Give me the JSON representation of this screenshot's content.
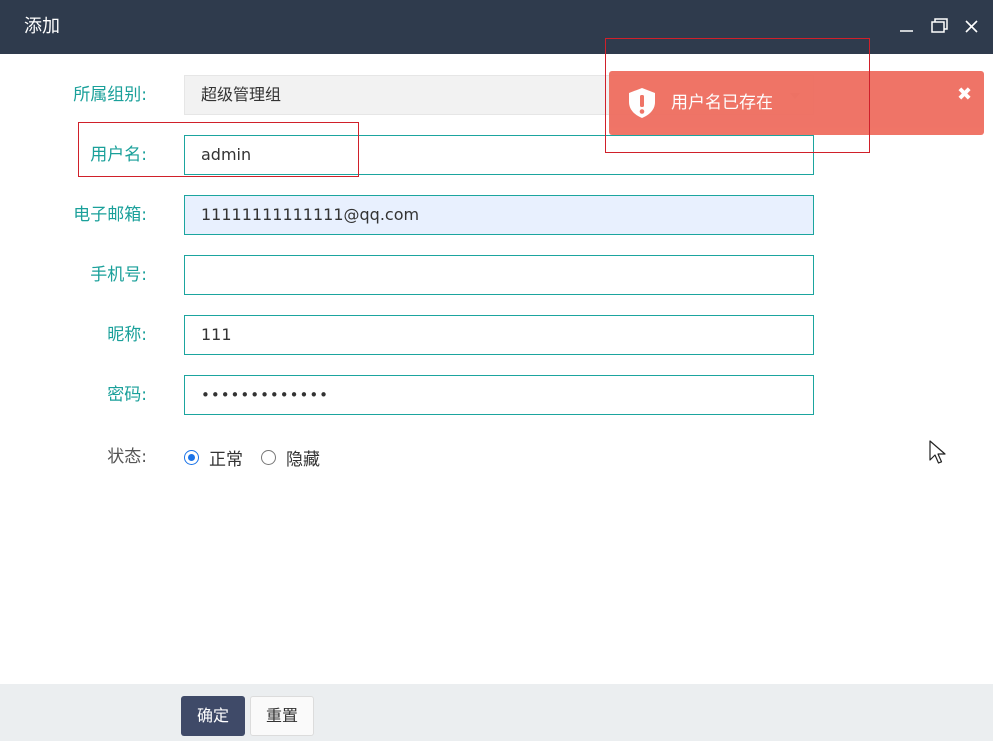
{
  "window": {
    "title": "添加",
    "controls": [
      "minimize-icon",
      "maximize-icon",
      "close-icon"
    ]
  },
  "form": {
    "group": {
      "label": "所属组别:",
      "value": "超级管理组"
    },
    "username": {
      "label": "用户名:",
      "value": "admin"
    },
    "email": {
      "label": "电子邮箱:",
      "value": "11111111111111@qq.com"
    },
    "mobile": {
      "label": "手机号:",
      "value": ""
    },
    "nickname": {
      "label": "昵称:",
      "value": "111"
    },
    "password": {
      "label": "密码:",
      "value": "•••••••••••••"
    },
    "status": {
      "label": "状态:",
      "options": [
        {
          "label": "正常",
          "checked": true
        },
        {
          "label": "隐藏",
          "checked": false
        }
      ]
    }
  },
  "toast": {
    "message": "用户名已存在",
    "icon": "shield-alert-icon",
    "close": "✖",
    "color": "#ef6f61"
  },
  "footer": {
    "confirm_label": "确定",
    "reset_label": "重置"
  },
  "colors": {
    "titlebar": "#2f3b4d",
    "accent": "#1aa09a",
    "primary_button": "#3f4a68"
  }
}
